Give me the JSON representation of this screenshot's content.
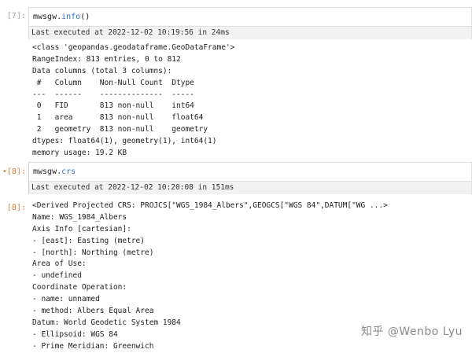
{
  "cells": [
    {
      "prompt": "[7]:",
      "code_prefix": "mwsgw.",
      "code_attr": "info",
      "code_suffix": "()",
      "exec_status": "Last executed at 2022-12-02 10:19:56 in 24ms",
      "output_lines": [
        "<class 'geopandas.geodataframe.GeoDataFrame'>",
        "RangeIndex: 813 entries, 0 to 812",
        "Data columns (total 3 columns):",
        " #   Column    Non-Null Count  Dtype",
        "---  ------    --------------  -----",
        " 0   FID       813 non-null    int64",
        " 1   area      813 non-null    float64",
        " 2   geometry  813 non-null    geometry",
        "dtypes: float64(1), geometry(1), int64(1)",
        "memory usage: 19.2 KB"
      ]
    },
    {
      "prompt": "[8]:",
      "prompt_marker": "•",
      "code_prefix": "mwsgw.",
      "code_attr": "crs",
      "code_suffix": "",
      "exec_status": "Last executed at 2022-12-02 10:20:08 in 151ms",
      "output_prompt": "[8]:",
      "output_lines": [
        "<Derived Projected CRS: PROJCS[\"WGS_1984_Albers\",GEOGCS[\"WGS 84\",DATUM[\"WG ...>",
        "Name: WGS_1984_Albers",
        "Axis Info [cartesian]:",
        "- [east]: Easting (metre)",
        "- [north]: Northing (metre)",
        "Area of Use:",
        "- undefined",
        "Coordinate Operation:",
        "- name: unnamed",
        "- method: Albers Equal Area",
        "Datum: World Geodetic System 1984",
        "- Ellipsoid: WGS 84",
        "- Prime Meridian: Greenwich"
      ]
    }
  ],
  "watermark": "知乎 @Wenbo Lyu",
  "colors": {
    "attr": "#2f6fc2",
    "prompt": "#9e9e9e",
    "out_prompt": "#e07a3a",
    "cell_border": "#e0e0e0"
  }
}
